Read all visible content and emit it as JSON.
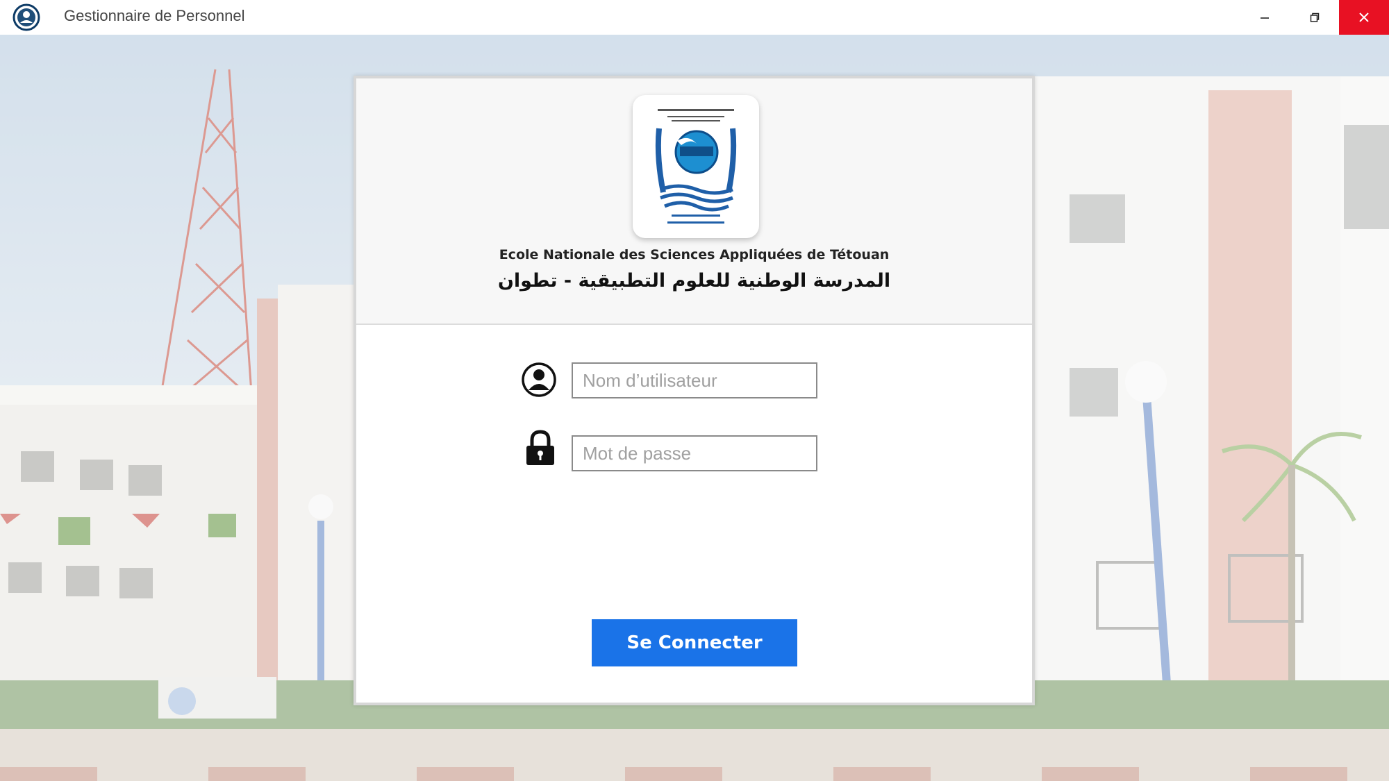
{
  "window": {
    "title": "Gestionnaire de Personnel",
    "close_color": "#e81123"
  },
  "header": {
    "logo_icon": "ensa-logo",
    "school_name_fr": "Ecole Nationale des Sciences Appliquées de Tétouan",
    "school_name_ar": "المدرسة الوطنية للعلوم التطبيقية - تطوان"
  },
  "login": {
    "username_placeholder": "Nom d’utilisateur",
    "username_value": "",
    "password_placeholder": "Mot de passe",
    "password_value": "",
    "submit_label": "Se Connecter",
    "accent_color": "#1a73e8"
  }
}
